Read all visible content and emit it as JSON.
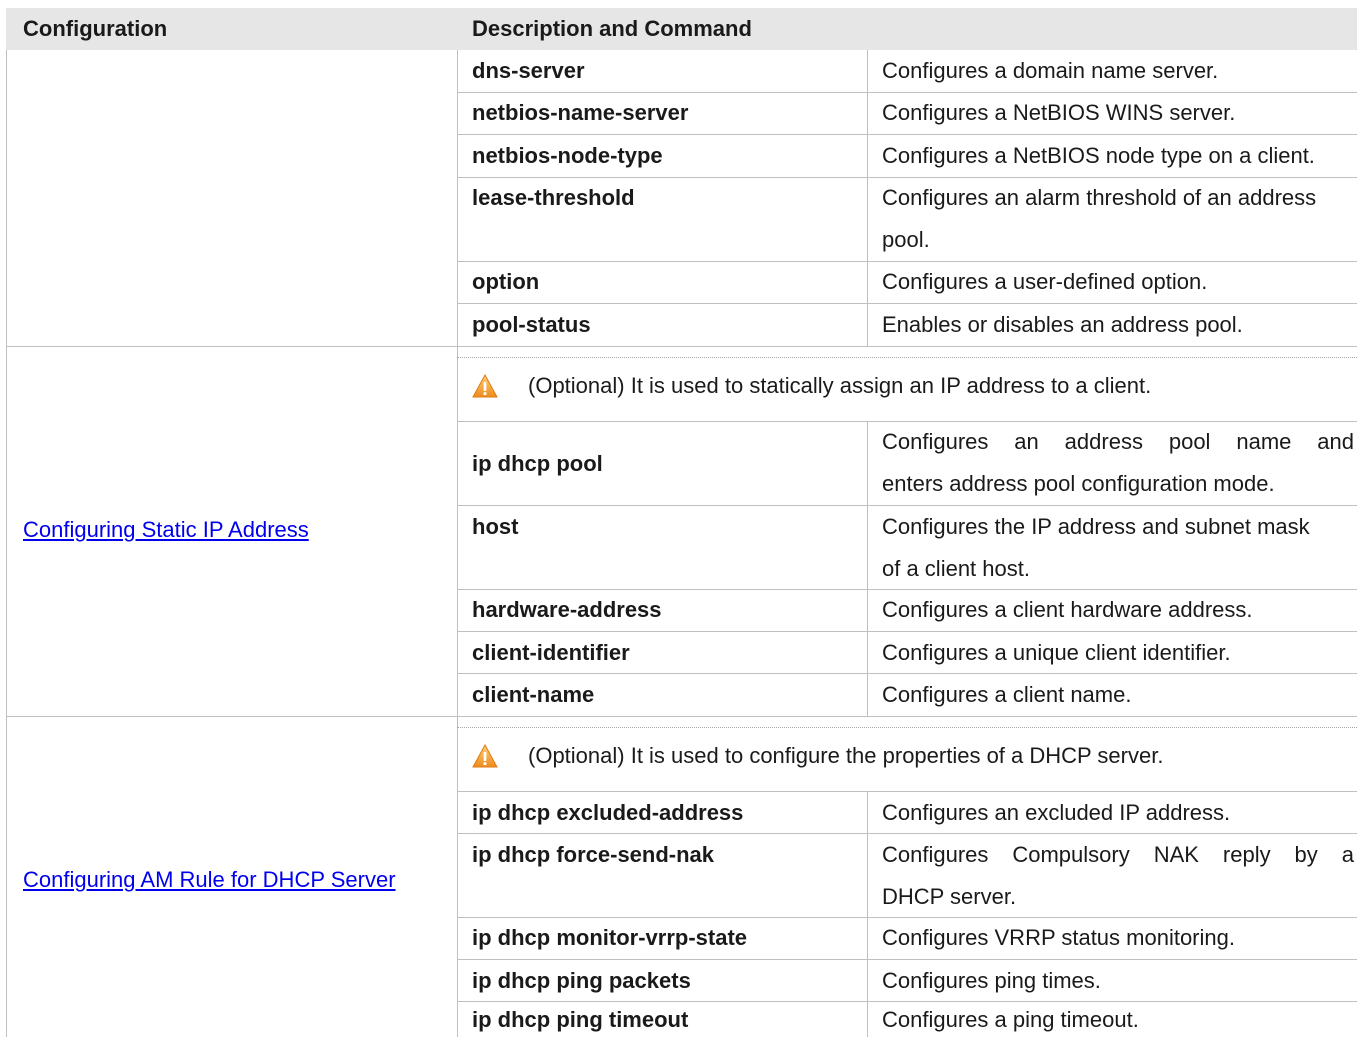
{
  "header": {
    "col1": "Configuration",
    "col2": "Description and Command"
  },
  "section1": {
    "rows": [
      {
        "command": "dns-server",
        "description": "Configures a domain name server."
      },
      {
        "command": "netbios-name-server",
        "description": "Configures a NetBIOS WINS server."
      },
      {
        "command": "netbios-node-type",
        "description": "Configures a NetBIOS node type on a client."
      },
      {
        "command": "lease-threshold",
        "description": "Configures an alarm threshold of an address",
        "description2": "pool."
      },
      {
        "command": "option",
        "description": "Configures a user-defined option."
      },
      {
        "command": "pool-status",
        "description": "Enables or disables an address pool."
      }
    ]
  },
  "section2": {
    "link": "Configuring Static IP Address",
    "note": "(Optional) It is used to statically assign an IP address to a client.",
    "rows": [
      {
        "command": "ip dhcp pool",
        "description": "Configures an address pool name and",
        "description2": "enters address pool configuration mode."
      },
      {
        "command": "host",
        "description": "Configures the IP address and subnet mask",
        "description2": "of a client host."
      },
      {
        "command": "hardware-address",
        "description": "Configures a client hardware address."
      },
      {
        "command": "client-identifier",
        "description": "Configures a unique client identifier."
      },
      {
        "command": "client-name",
        "description": "Configures a client name."
      }
    ]
  },
  "section3": {
    "link": "Configuring AM Rule for DHCP Server",
    "note": "(Optional) It is used to configure the properties of a DHCP server.",
    "rows": [
      {
        "command": "ip dhcp excluded-address",
        "description": "Configures an excluded IP address."
      },
      {
        "command": "ip dhcp force-send-nak",
        "description": "Configures Compulsory NAK reply by a",
        "description2": "DHCP server."
      },
      {
        "command": "ip dhcp monitor-vrrp-state",
        "description": "Configures VRRP status monitoring."
      },
      {
        "command": "ip dhcp ping packets",
        "description": "Configures ping times."
      },
      {
        "command": "ip dhcp ping timeout",
        "description": "Configures a ping timeout."
      }
    ]
  },
  "colors": {
    "header_bg": "#e6e6e6",
    "border": "#bfbfbf",
    "link": "#0000ee",
    "warning_icon": "#f39c12"
  }
}
